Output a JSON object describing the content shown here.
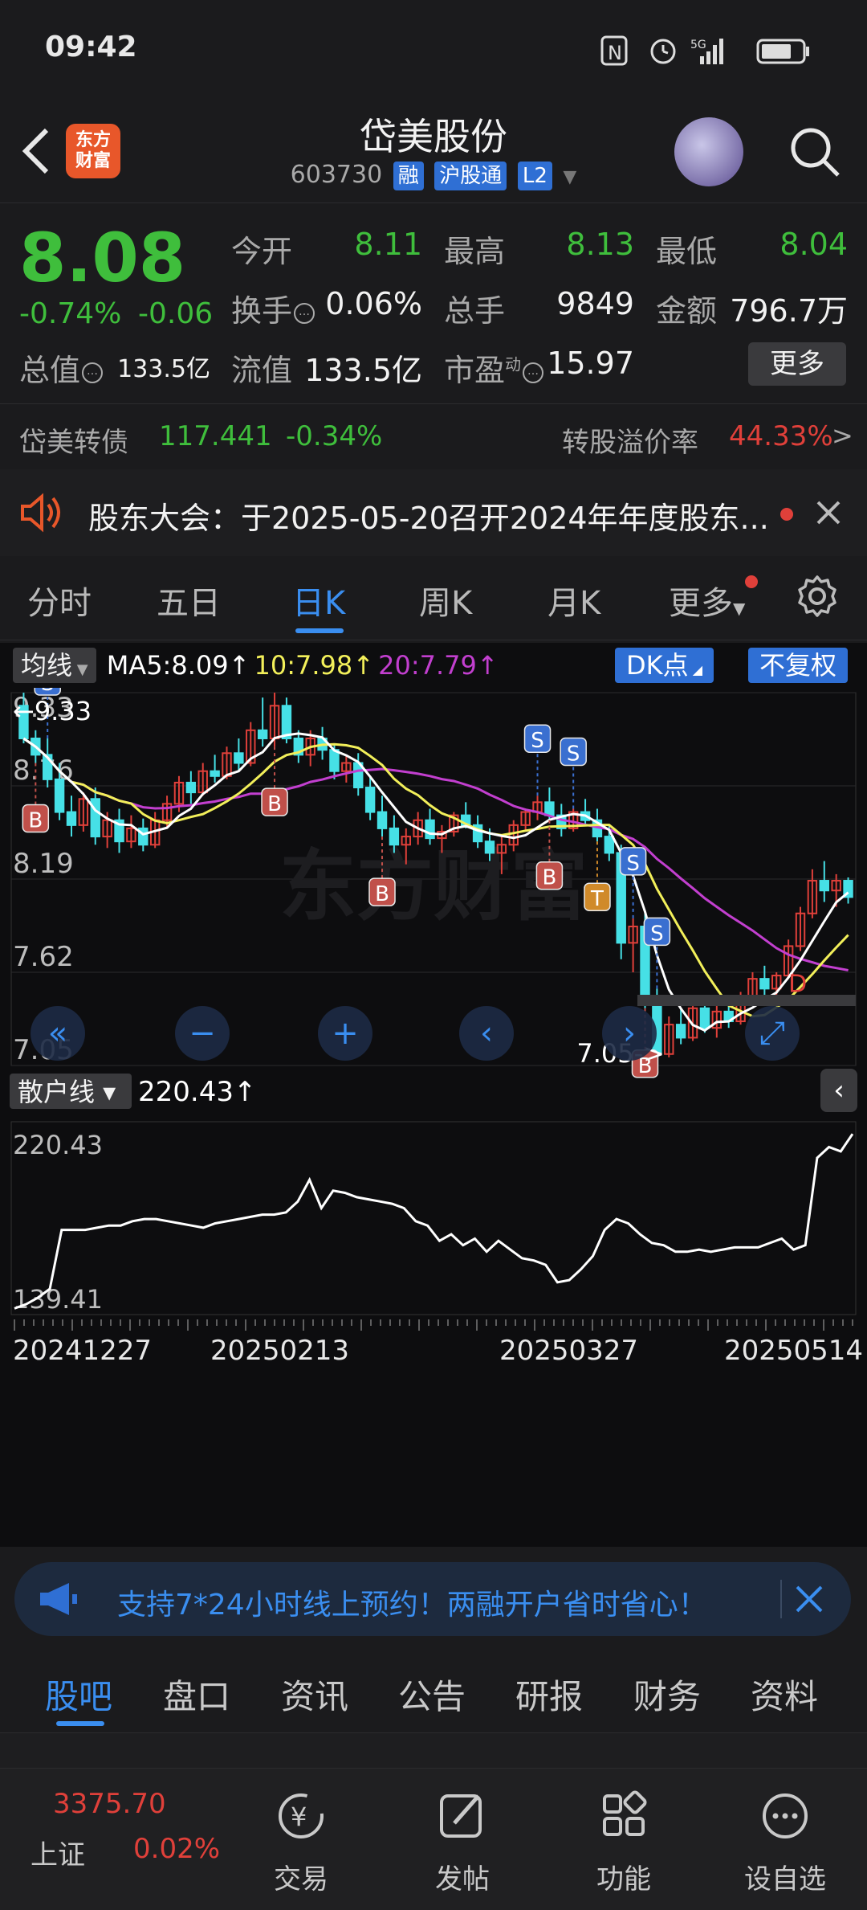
{
  "status_bar": {
    "time": "09:42",
    "signal_label": "5G"
  },
  "header": {
    "title": "岱美股份",
    "code": "603730",
    "tags": [
      "融",
      "沪股通",
      "L2"
    ],
    "logo_text": [
      "东方",
      "财富"
    ]
  },
  "quote": {
    "price": "8.08",
    "change_pct": "-0.74%",
    "change_abs": "-0.06",
    "fields": {
      "open": {
        "label": "今开",
        "value": "8.11"
      },
      "high": {
        "label": "最高",
        "value": "8.13"
      },
      "low": {
        "label": "最低",
        "value": "8.04"
      },
      "turnover": {
        "label": "换手",
        "value": "0.06%"
      },
      "volume": {
        "label": "总手",
        "value": "9849"
      },
      "amount": {
        "label": "金额",
        "value": "796.7万"
      },
      "mktcap": {
        "label": "总值",
        "value": "133.5亿"
      },
      "float": {
        "label": "流值",
        "value": "133.5亿"
      },
      "pe": {
        "label": "市盈",
        "sup": "动",
        "value": "15.97"
      }
    },
    "more_label": "更多"
  },
  "convertible_bond": {
    "name": "岱美转债",
    "price": "117.441",
    "change": "-0.34%",
    "premium_label": "转股溢价率",
    "premium_value": "44.33%",
    "arrow": ">"
  },
  "announcement": {
    "text": "股东大会：于2025-05-20召开2024年年度股东..."
  },
  "chart_tabs": [
    "分时",
    "五日",
    "日K",
    "周K",
    "月K",
    "更多"
  ],
  "active_tab": "日K",
  "chart_controls": {
    "ma_selector": "均线",
    "ma5": "MA5:8.09",
    "ma10": "10:7.98",
    "ma20": "20:7.79",
    "dk_label": "DK点",
    "adjust_label": "不复权",
    "watermark": "东方财富",
    "high_marker": "9.33",
    "low_marker": "7.05->",
    "sub_selector": "散户线",
    "sub_value": "220.43"
  },
  "chart_data": [
    {
      "type": "candlestick",
      "y_ticks": [
        "9.33",
        "8.76",
        "8.19",
        "7.62",
        "7.05"
      ],
      "ylim": [
        7.05,
        9.33
      ],
      "x_ticks": [
        "20241227",
        "20250213",
        "20250327",
        "20250514"
      ],
      "colors": {
        "up": "#e0403a",
        "down": "#46e0e6",
        "ma5": "#ffffff",
        "ma10": "#f2ef5a",
        "ma20": "#c23fcf"
      },
      "candles": [
        [
          9.25,
          9.33,
          9.02,
          9.05
        ],
        [
          9.05,
          9.1,
          8.9,
          8.95
        ],
        [
          8.95,
          9.05,
          8.75,
          8.8
        ],
        [
          8.8,
          8.9,
          8.55,
          8.6
        ],
        [
          8.6,
          8.7,
          8.45,
          8.52
        ],
        [
          8.52,
          8.72,
          8.48,
          8.68
        ],
        [
          8.68,
          8.75,
          8.4,
          8.45
        ],
        [
          8.45,
          8.6,
          8.38,
          8.55
        ],
        [
          8.55,
          8.62,
          8.35,
          8.42
        ],
        [
          8.42,
          8.58,
          8.38,
          8.5
        ],
        [
          8.5,
          8.56,
          8.36,
          8.4
        ],
        [
          8.4,
          8.6,
          8.38,
          8.55
        ],
        [
          8.55,
          8.7,
          8.5,
          8.65
        ],
        [
          8.65,
          8.82,
          8.6,
          8.78
        ],
        [
          8.78,
          8.85,
          8.65,
          8.72
        ],
        [
          8.72,
          8.9,
          8.7,
          8.85
        ],
        [
          8.85,
          8.95,
          8.78,
          8.82
        ],
        [
          8.82,
          9.0,
          8.8,
          8.96
        ],
        [
          8.96,
          9.05,
          8.85,
          8.9
        ],
        [
          8.9,
          9.15,
          8.88,
          9.1
        ],
        [
          9.1,
          9.3,
          9.0,
          9.05
        ],
        [
          9.05,
          9.33,
          9.0,
          9.25
        ],
        [
          9.25,
          9.3,
          9.02,
          9.05
        ],
        [
          9.05,
          9.1,
          8.9,
          8.95
        ],
        [
          8.95,
          9.1,
          8.88,
          9.05
        ],
        [
          9.05,
          9.12,
          8.92,
          8.98
        ],
        [
          8.98,
          9.02,
          8.8,
          8.85
        ],
        [
          8.85,
          8.95,
          8.78,
          8.9
        ],
        [
          8.9,
          8.96,
          8.7,
          8.75
        ],
        [
          8.75,
          8.82,
          8.55,
          8.6
        ],
        [
          8.6,
          8.7,
          8.45,
          8.5
        ],
        [
          8.5,
          8.58,
          8.35,
          8.4
        ],
        [
          8.4,
          8.5,
          8.28,
          8.45
        ],
        [
          8.45,
          8.6,
          8.4,
          8.55
        ],
        [
          8.55,
          8.62,
          8.4,
          8.44
        ],
        [
          8.44,
          8.52,
          8.35,
          8.48
        ],
        [
          8.48,
          8.6,
          8.45,
          8.58
        ],
        [
          8.58,
          8.66,
          8.5,
          8.52
        ],
        [
          8.52,
          8.58,
          8.38,
          8.42
        ],
        [
          8.42,
          8.5,
          8.3,
          8.35
        ],
        [
          8.35,
          8.45,
          8.22,
          8.4
        ],
        [
          8.4,
          8.55,
          8.36,
          8.52
        ],
        [
          8.52,
          8.62,
          8.48,
          8.6
        ],
        [
          8.6,
          8.7,
          8.55,
          8.66
        ],
        [
          8.66,
          8.75,
          8.55,
          8.58
        ],
        [
          8.58,
          8.65,
          8.45,
          8.5
        ],
        [
          8.5,
          8.62,
          8.48,
          8.6
        ],
        [
          8.6,
          8.68,
          8.52,
          8.55
        ],
        [
          8.55,
          8.62,
          8.42,
          8.45
        ],
        [
          8.45,
          8.52,
          8.3,
          8.35
        ],
        [
          8.35,
          8.4,
          7.7,
          7.8
        ],
        [
          7.8,
          7.95,
          7.62,
          7.9
        ],
        [
          7.9,
          7.98,
          7.4,
          7.45
        ],
        [
          7.45,
          7.52,
          7.05,
          7.12
        ],
        [
          7.12,
          7.35,
          7.1,
          7.3
        ],
        [
          7.3,
          7.4,
          7.18,
          7.22
        ],
        [
          7.22,
          7.45,
          7.2,
          7.4
        ],
        [
          7.4,
          7.48,
          7.25,
          7.28
        ],
        [
          7.28,
          7.42,
          7.22,
          7.38
        ],
        [
          7.38,
          7.45,
          7.28,
          7.32
        ],
        [
          7.32,
          7.5,
          7.3,
          7.46
        ],
        [
          7.46,
          7.62,
          7.42,
          7.58
        ],
        [
          7.58,
          7.66,
          7.48,
          7.52
        ],
        [
          7.52,
          7.62,
          7.45,
          7.6
        ],
        [
          7.6,
          7.82,
          7.58,
          7.78
        ],
        [
          7.78,
          8.02,
          7.75,
          7.98
        ],
        [
          7.98,
          8.25,
          7.95,
          8.18
        ],
        [
          8.18,
          8.3,
          8.05,
          8.12
        ],
        [
          8.12,
          8.22,
          8.02,
          8.18
        ],
        [
          8.18,
          8.2,
          8.04,
          8.08
        ]
      ]
    },
    {
      "type": "line",
      "y_ticks": [
        "220.43",
        "139.41"
      ],
      "ylim": [
        139.41,
        220.43
      ],
      "values": [
        140,
        142,
        145,
        149,
        176,
        176,
        176,
        177,
        178,
        178,
        180,
        181,
        181,
        180,
        179,
        178,
        177,
        179,
        180,
        181,
        182,
        183,
        183,
        184,
        189,
        199,
        186,
        194,
        193,
        191,
        190,
        189,
        188,
        186,
        180,
        178,
        171,
        174,
        169,
        172,
        166,
        171,
        167,
        163,
        162,
        160,
        152,
        153,
        158,
        164,
        176,
        181,
        179,
        174,
        170,
        169,
        166,
        166,
        167,
        166,
        167,
        168,
        168,
        168,
        170,
        172,
        167,
        169,
        209,
        214,
        212,
        220
      ]
    }
  ],
  "signals": {
    "S": "S",
    "B": "B",
    "T": "T",
    "D": "D"
  },
  "promo_banner": {
    "text": "支持7*24小时线上预约！两融开户省时省心！"
  },
  "bottom_tabs": [
    "股吧",
    "盘口",
    "资讯",
    "公告",
    "研报",
    "财务",
    "资料"
  ],
  "active_bottom_tab": "股吧",
  "bottom_nav": {
    "index_value": "3375.70",
    "index_name": "上证",
    "index_change": "0.02%",
    "items": [
      "交易",
      "发帖",
      "功能",
      "设自选"
    ]
  }
}
